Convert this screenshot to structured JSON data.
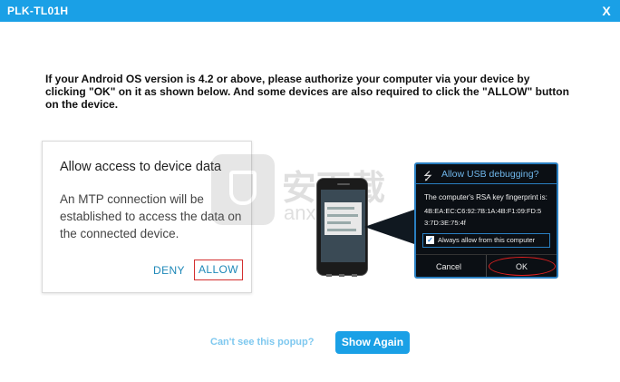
{
  "window": {
    "title": "PLK-TL01H",
    "close_label": "X"
  },
  "instruction": "If your Android OS version is 4.2 or above, please authorize your computer via your device by clicking \"OK\" on it as shown below. And some devices are also required to click the \"ALLOW\" button on the device.",
  "mtp_dialog": {
    "title": "Allow access to device data",
    "body": "An MTP connection will be established to access the data on the connected device.",
    "deny_label": "DENY",
    "allow_label": "ALLOW"
  },
  "usb_dialog": {
    "icon": "usb-icon",
    "title": "Allow USB debugging?",
    "fingerprint_label": "The computer's RSA key fingerprint is:",
    "fingerprint_line1": "4B:EA:EC:C6:92:7B:1A:4B:F1:09:FD:5",
    "fingerprint_line2": "3:7D:3E:75:4f",
    "always_allow_label": "Always allow from this computer",
    "always_allow_checked": true,
    "cancel_label": "Cancel",
    "ok_label": "OK"
  },
  "watermark": {
    "text": "安下载",
    "domain": "anxz.com"
  },
  "footer": {
    "cant_see_label": "Can't see this popup?",
    "show_again_label": "Show Again"
  },
  "colors": {
    "accent": "#1aa0e6",
    "highlight": "#e02020",
    "link": "#7ec8ef"
  }
}
